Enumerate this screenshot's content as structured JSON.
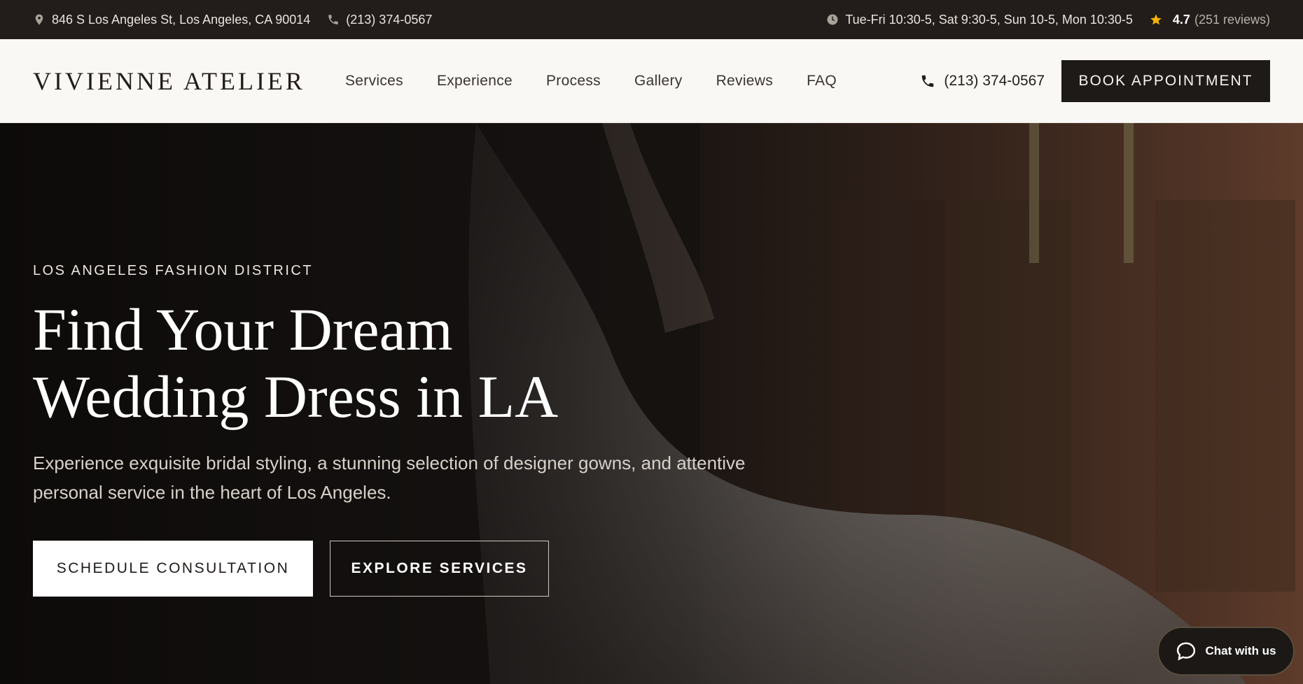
{
  "topbar": {
    "address": "846 S Los Angeles St, Los Angeles, CA 90014",
    "phone": "(213) 374-0567",
    "hours": "Tue-Fri 10:30-5, Sat 9:30-5, Sun 10-5, Mon 10:30-5",
    "rating": "4.7",
    "reviews": "(251 reviews)",
    "icons": [
      "map-pin-icon",
      "phone-icon",
      "clock-icon",
      "star-icon"
    ]
  },
  "header": {
    "logo": "VIVIENNE ATELIER",
    "nav": [
      "Services",
      "Experience",
      "Process",
      "Gallery",
      "Reviews",
      "FAQ"
    ],
    "phone": "(213) 374-0567",
    "book_label": "BOOK APPOINTMENT"
  },
  "hero": {
    "eyebrow": "LOS ANGELES FASHION DISTRICT",
    "title_line1": "Find Your Dream",
    "title_line2": "Wedding Dress in LA",
    "description": "Experience exquisite bridal styling, a stunning selection of designer gowns, and attentive personal service in the heart of Los Angeles.",
    "primary_cta": "SCHEDULE CONSULTATION",
    "secondary_cta": "EXPLORE SERVICES"
  },
  "chat": {
    "label": "Chat with us"
  },
  "colors": {
    "dark": "#221d1b",
    "header_bg": "#faf8f5",
    "accent_star": "#f5b400"
  }
}
